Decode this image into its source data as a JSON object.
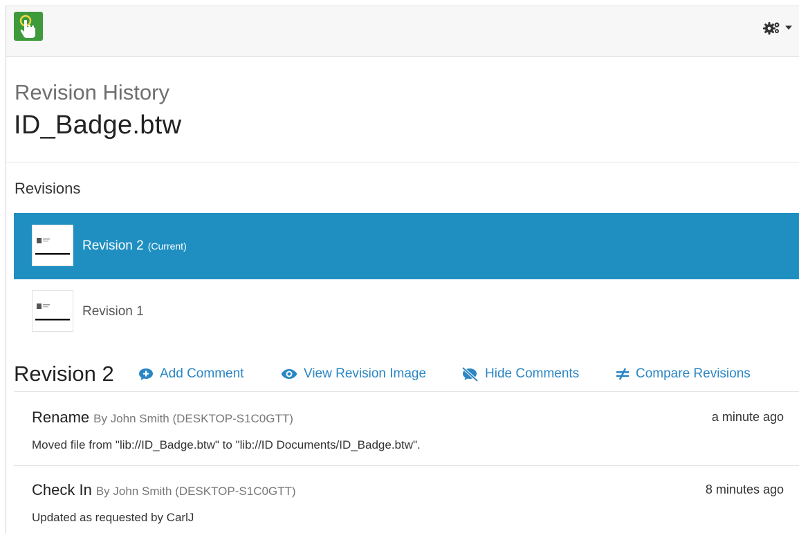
{
  "app": {
    "logo_icon": "hand-pointer-icon",
    "settings_icon": "gears-icon",
    "brand_color": "#3e9a3a"
  },
  "header": {
    "subtitle": "Revision History",
    "filename": "ID_Badge.btw"
  },
  "revisions": {
    "section_title": "Revisions",
    "items": [
      {
        "label": "Revision 2",
        "tag": "(Current)",
        "selected": true
      },
      {
        "label": "Revision 1",
        "tag": "",
        "selected": false
      }
    ],
    "selected_color": "#1f8fc1"
  },
  "detail": {
    "title": "Revision 2",
    "actions": [
      {
        "label": "Add Comment",
        "icon": "comment-plus-icon"
      },
      {
        "label": "View Revision Image",
        "icon": "eye-icon"
      },
      {
        "label": "Hide Comments",
        "icon": "comment-slash-icon"
      },
      {
        "label": "Compare Revisions",
        "icon": "not-equal-icon"
      }
    ],
    "entries": [
      {
        "type": "Rename",
        "by": "By John Smith (DESKTOP-S1C0GTT)",
        "time": "a minute ago",
        "message": "Moved file from \"lib://ID_Badge.btw\" to \"lib://ID Documents/ID_Badge.btw\"."
      },
      {
        "type": "Check In",
        "by": "By John Smith (DESKTOP-S1C0GTT)",
        "time": "8 minutes ago",
        "message": "Updated as requested by CarlJ"
      }
    ]
  }
}
